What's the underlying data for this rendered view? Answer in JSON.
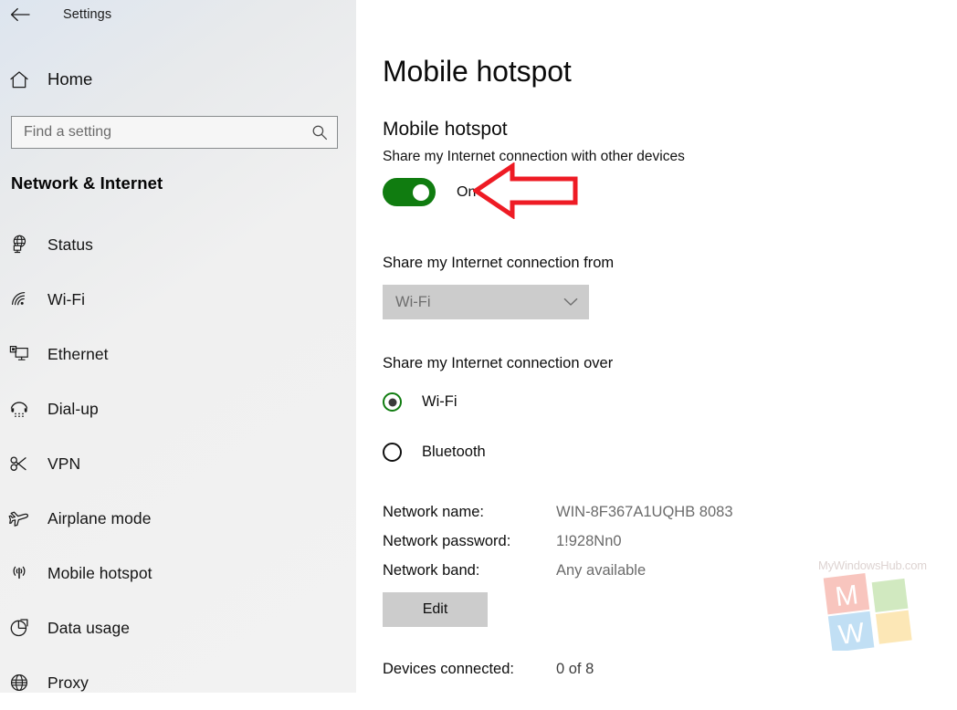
{
  "window": {
    "title": "Settings",
    "back_icon": "back-arrow-icon"
  },
  "sidebar": {
    "home": {
      "label": "Home",
      "icon": "home-icon"
    },
    "search": {
      "value": "",
      "placeholder": "Find a setting",
      "icon": "search-icon"
    },
    "section_title": "Network & Internet",
    "items": [
      {
        "label": "Status",
        "icon": "globe-status-icon"
      },
      {
        "label": "Wi-Fi",
        "icon": "wifi-icon"
      },
      {
        "label": "Ethernet",
        "icon": "ethernet-icon"
      },
      {
        "label": "Dial-up",
        "icon": "dialup-phone-icon"
      },
      {
        "label": "VPN",
        "icon": "vpn-key-icon"
      },
      {
        "label": "Airplane mode",
        "icon": "airplane-icon"
      },
      {
        "label": "Mobile hotspot",
        "icon": "hotspot-antenna-icon"
      },
      {
        "label": "Data usage",
        "icon": "pie-chart-icon"
      },
      {
        "label": "Proxy",
        "icon": "globe-icon"
      }
    ]
  },
  "main": {
    "page_title": "Mobile hotspot",
    "group_title": "Mobile hotspot",
    "group_subtitle": "Share my Internet connection with other devices",
    "toggle": {
      "state_label": "On",
      "checked": true,
      "on_color": "#107c10"
    },
    "share_from": {
      "label": "Share my Internet connection from",
      "selected": "Wi-Fi",
      "chevron_icon": "chevron-down-icon"
    },
    "share_over": {
      "label": "Share my Internet connection over",
      "options": [
        {
          "label": "Wi-Fi",
          "selected": true
        },
        {
          "label": "Bluetooth",
          "selected": false
        }
      ],
      "selected_color": "#107c10"
    },
    "details": [
      {
        "key": "Network name:",
        "value": "WIN-8F367A1UQHB 8083"
      },
      {
        "key": "Network password:",
        "value": "1!928Nn0"
      },
      {
        "key": "Network band:",
        "value": "Any available"
      }
    ],
    "edit_button": "Edit",
    "devices": {
      "key": "Devices connected:",
      "value": "0 of 8"
    }
  },
  "annotation": {
    "arrow_icon": "left-arrow-annotation",
    "arrow_color": "#ee1b24"
  },
  "watermark": {
    "text": "MyWindowsHub.com",
    "logo_icon": "mywindowshub-logo",
    "tiles": {
      "top_left": "M",
      "bottom_left": "W",
      "top_right_color": "#b6dd9b",
      "bottom_right_color": "#fbd98a",
      "top_left_color": "#f4a397",
      "bottom_left_color": "#9ccdee"
    }
  }
}
